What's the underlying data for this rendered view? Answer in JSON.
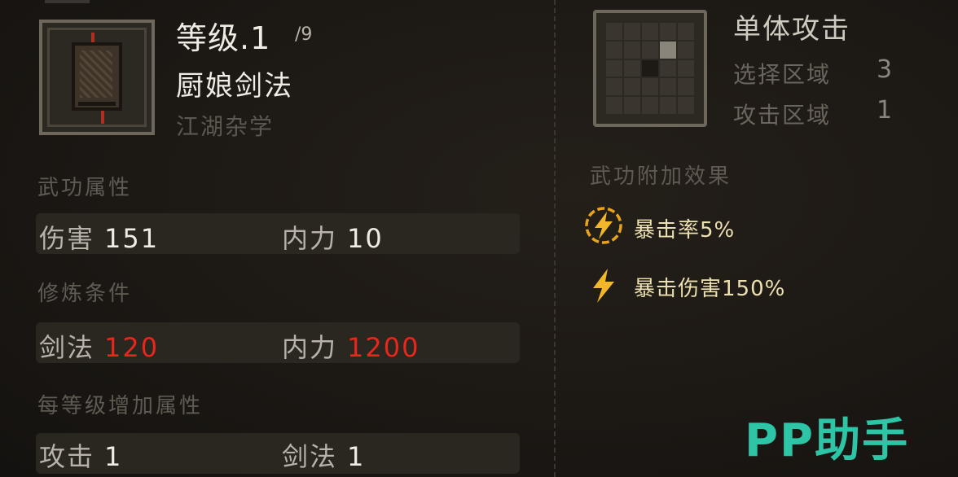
{
  "skill": {
    "level_label": "等级.1",
    "level_max": "/9",
    "name": "厨娘剑法",
    "type": "江湖杂学"
  },
  "sections": {
    "attributes_title": "武功属性",
    "requirements_title": "修炼条件",
    "per_level_title": "每等级增加属性"
  },
  "attributes": [
    {
      "label": "伤害",
      "value": "151"
    },
    {
      "label": "内力",
      "value": "10"
    }
  ],
  "requirements": [
    {
      "label": "剑法",
      "value": "120"
    },
    {
      "label": "内力",
      "value": "1200"
    }
  ],
  "per_level": [
    {
      "label": "攻击",
      "value": "1"
    },
    {
      "label": "剑法",
      "value": "1"
    }
  ],
  "attack": {
    "type": "单体攻击",
    "select_area_label": "选择区域",
    "select_area_value": "3",
    "attack_area_label": "攻击区域",
    "attack_area_value": "1"
  },
  "effects": {
    "title": "武功附加效果",
    "items": [
      {
        "icon": "lightning-circle-icon",
        "text": "暴击率5%"
      },
      {
        "icon": "lightning-icon",
        "text": "暴击伤害150%"
      }
    ]
  },
  "colors": {
    "requirement_unmet": "#e8261c",
    "effect_text": "#ece0b0",
    "watermark": "#2ec4a6"
  },
  "watermark": "PP助手"
}
